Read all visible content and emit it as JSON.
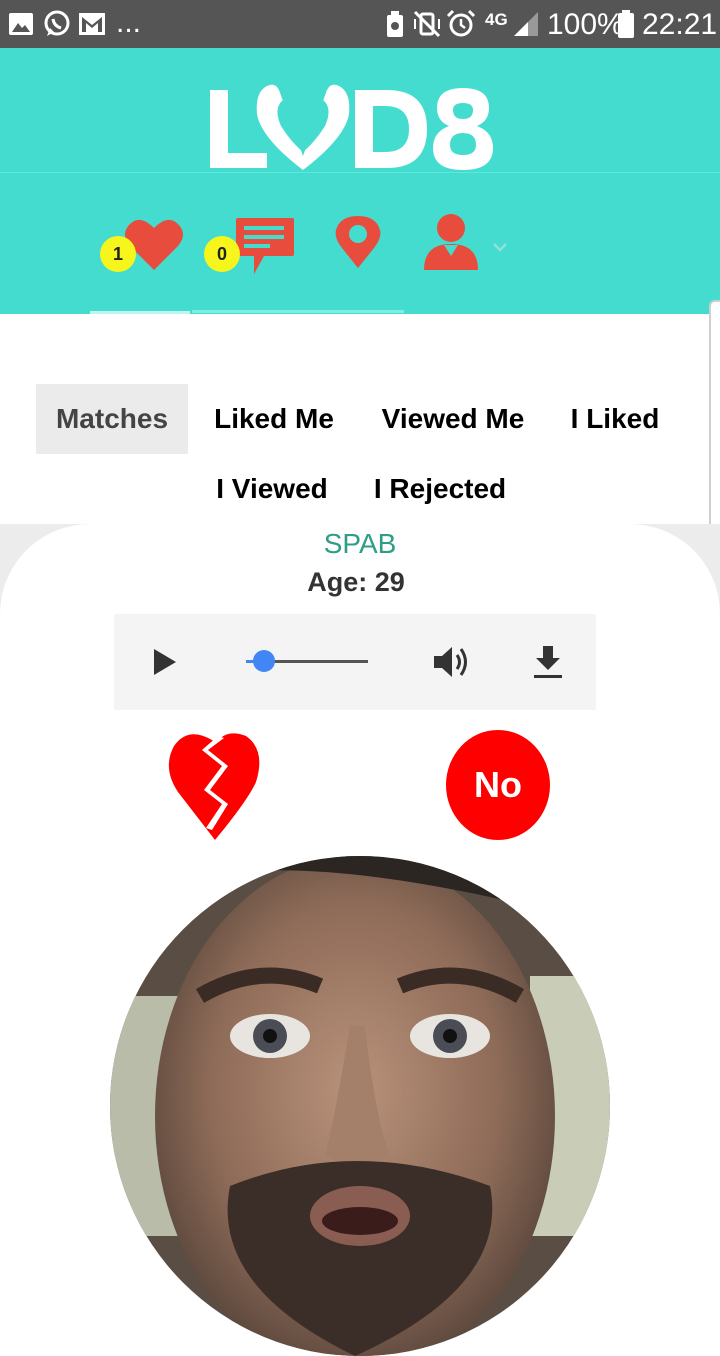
{
  "status_bar": {
    "dots": "...",
    "network": "4G",
    "battery": "100%",
    "time": "22:21"
  },
  "app": {
    "logo_text": "LOD8"
  },
  "nav": {
    "likes_count": "1",
    "messages_count": "0"
  },
  "filters": {
    "tabs": [
      "Matches",
      "Liked Me",
      "Viewed Me",
      "I Liked",
      "I Viewed",
      "I Rejected"
    ],
    "active": "Matches"
  },
  "profile": {
    "name": "SPAB",
    "age": "Age: 29",
    "reject_label": "No"
  },
  "audio": {
    "progress": 0.15
  },
  "colors": {
    "header": "#45dcd0",
    "accent_red": "#e74c3c",
    "badge": "#f6f61c",
    "reject": "#ff0000",
    "name": "#2e9e86"
  },
  "icons": {
    "status_left": [
      "image-icon",
      "whatsapp-icon",
      "gmail-icon"
    ],
    "status_right": [
      "recycle-notification-icon",
      "mute-vibrate-icon",
      "alarm-icon",
      "signal-icon",
      "battery-icon"
    ],
    "nav": [
      "heart-icon",
      "chat-icon",
      "location-pin-icon",
      "user-icon",
      "chevron-down-icon"
    ],
    "player": [
      "play-icon",
      "volume-icon",
      "download-icon"
    ],
    "card": [
      "broken-heart-icon"
    ]
  }
}
